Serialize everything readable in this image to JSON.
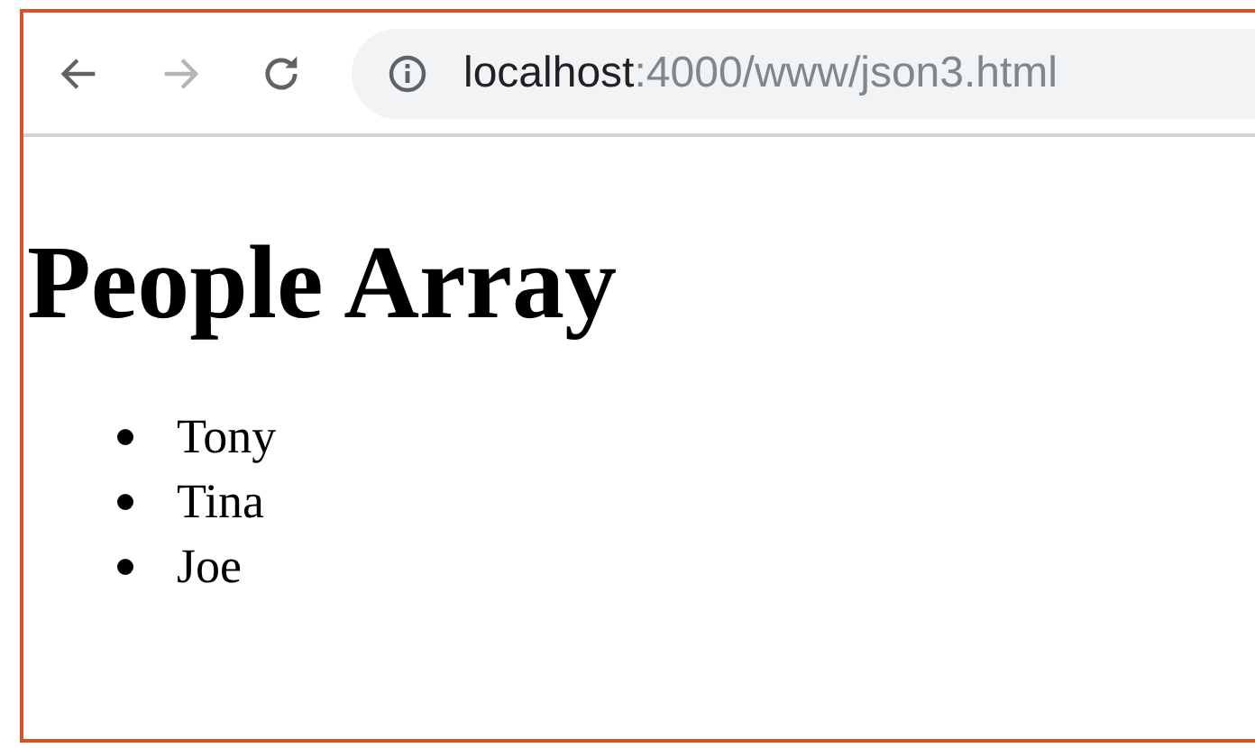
{
  "toolbar": {
    "back": {
      "disabled": false
    },
    "forward": {
      "disabled": true
    },
    "address": {
      "host": "localhost",
      "rest": ":4000/www/json3.html"
    }
  },
  "page": {
    "heading": "People Array",
    "people": [
      "Tony",
      "Tina",
      "Joe"
    ]
  }
}
